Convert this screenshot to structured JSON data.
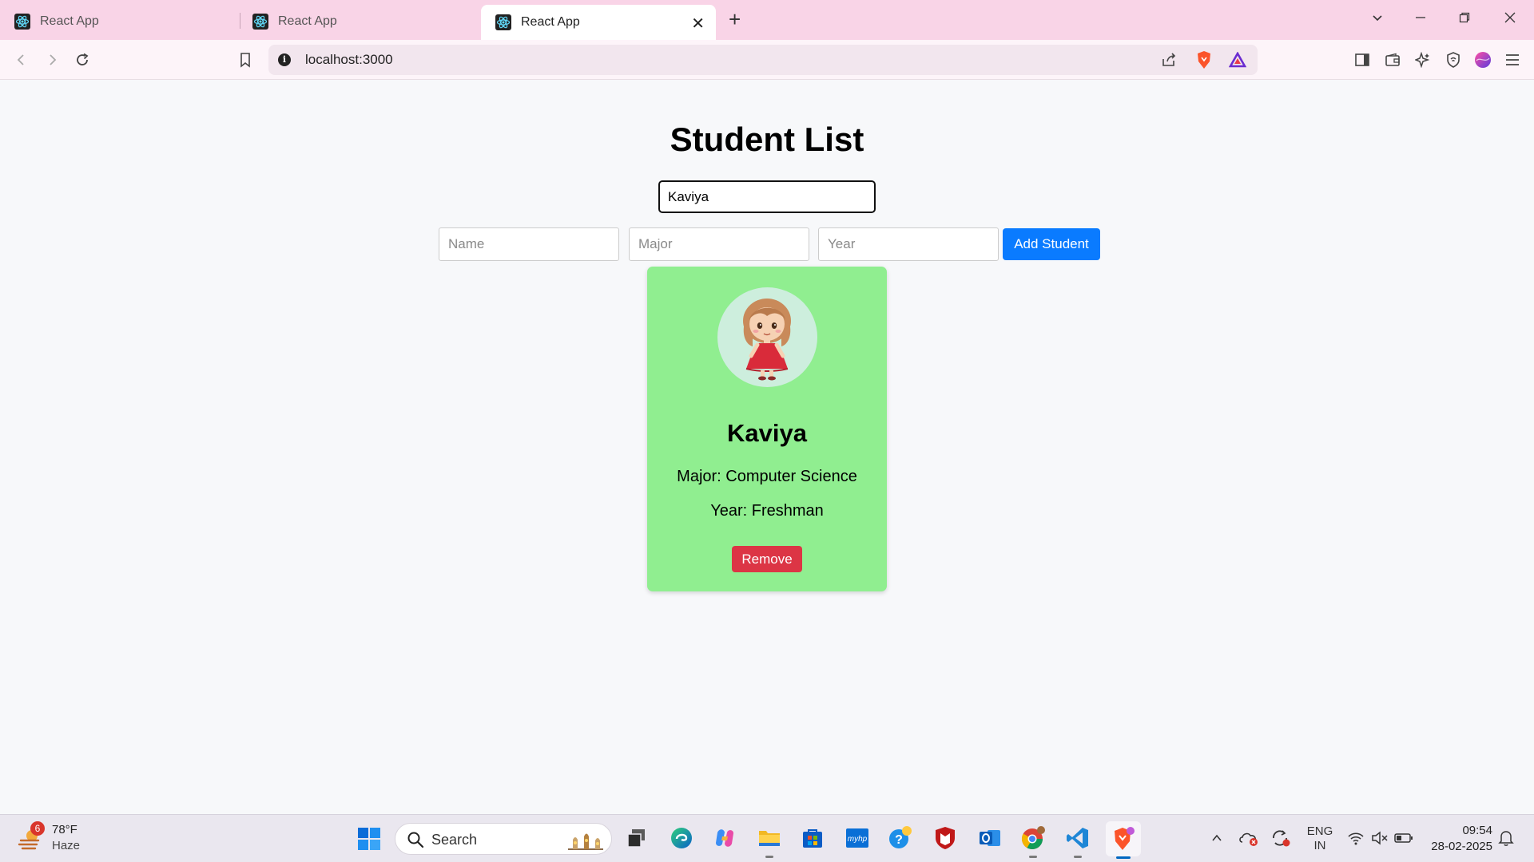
{
  "browser": {
    "tabs": [
      {
        "title": "React App"
      },
      {
        "title": "React App"
      },
      {
        "title": "React App"
      }
    ],
    "address": "localhost:3000"
  },
  "page": {
    "title": "Student List",
    "search_value": "Kaviya",
    "form": {
      "name_placeholder": "Name",
      "major_placeholder": "Major",
      "year_placeholder": "Year",
      "add_label": "Add Student"
    },
    "students": [
      {
        "name": "Kaviya",
        "major_line": "Major: Computer Science",
        "year_line": "Year: Freshman",
        "remove_label": "Remove"
      }
    ]
  },
  "taskbar": {
    "weather": {
      "temp": "78°F",
      "condition": "Haze",
      "badge": "6"
    },
    "search_label": "Search",
    "language": {
      "line1": "ENG",
      "line2": "IN"
    },
    "clock": {
      "time": "09:54",
      "date": "28-02-2025"
    }
  },
  "colors": {
    "tabbar": "#f9d4e7",
    "card": "#90ee90",
    "add_button": "#0a7bff",
    "remove_button": "#dc3545"
  }
}
